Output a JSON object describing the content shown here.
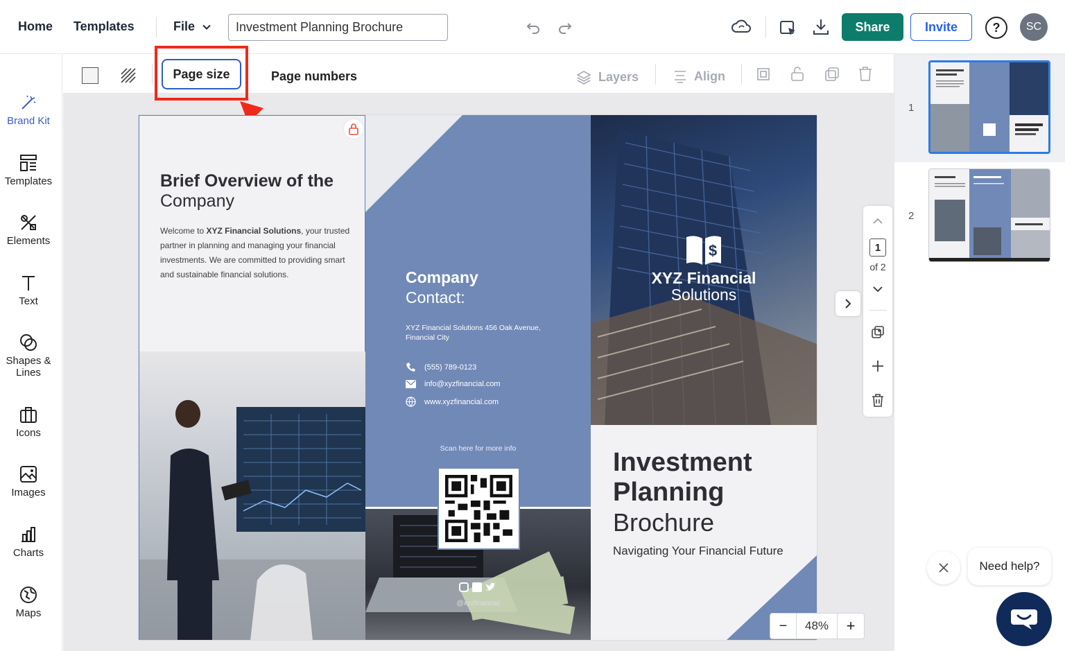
{
  "header": {
    "nav": [
      "Home",
      "Templates"
    ],
    "file_label": "File",
    "doc_title": "Investment Planning Brochure",
    "share_label": "Share",
    "invite_label": "Invite",
    "help_label": "?",
    "avatar_initials": "SC"
  },
  "sidebar": {
    "items": [
      {
        "label": "Brand Kit",
        "icon": "magic-wand-icon"
      },
      {
        "label": "Templates",
        "icon": "templates-icon"
      },
      {
        "label": "Elements",
        "icon": "elements-icon"
      },
      {
        "label": "Text",
        "icon": "text-icon"
      },
      {
        "label": "Shapes & Lines",
        "icon": "shapes-icon"
      },
      {
        "label": "Icons",
        "icon": "icons-icon"
      },
      {
        "label": "Images",
        "icon": "images-icon"
      },
      {
        "label": "Charts",
        "icon": "charts-icon"
      },
      {
        "label": "Maps",
        "icon": "maps-icon"
      }
    ]
  },
  "toolbar": {
    "page_size_label": "Page size",
    "page_numbers_label": "Page numbers",
    "layers_label": "Layers",
    "align_label": "Align"
  },
  "brochure": {
    "panel1": {
      "title": "Brief Overview of the",
      "subtitle": "Company",
      "body_pre": "Welcome to ",
      "body_bold": "XYZ Financial Solutions",
      "body_post": ", your trusted partner in planning and managing your financial investments. We are committed to providing smart and sustainable financial solutions."
    },
    "panel2": {
      "title": "Company",
      "subtitle": "Contact:",
      "address": "XYZ Financial Solutions 456 Oak Avenue, Financial City",
      "phone": "(555) 789-0123",
      "email": "info@xyzfinancial.com",
      "website": "www.xyzfinancial.com",
      "scan_text": "Scan here for more info",
      "handle": "@xyzfinancial"
    },
    "panel3": {
      "logo_title": "XYZ Financial",
      "logo_sub": "Solutions",
      "title_line1": "Investment",
      "title_line2": "Planning",
      "title_line3": "Brochure",
      "tagline": "Navigating Your Financial Future"
    }
  },
  "pager": {
    "current": "1",
    "total_label": "of 2"
  },
  "zoom": {
    "value": "48%",
    "minus": "−",
    "plus": "+"
  },
  "thumbnails": {
    "pages": [
      "1",
      "2"
    ]
  },
  "help": {
    "bubble_text": "Need help?"
  },
  "colors": {
    "accent_blue": "#2c5cc5",
    "share_green": "#0e7c6b",
    "annotation_red": "#f02a1a",
    "brochure_blue": "#7189b6",
    "chat_navy": "#102b5a"
  }
}
